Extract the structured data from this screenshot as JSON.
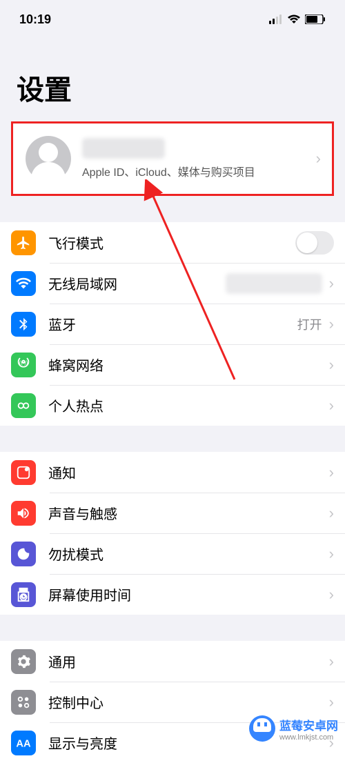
{
  "status": {
    "time": "10:19"
  },
  "title": "设置",
  "profile": {
    "subtitle": "Apple ID、iCloud、媒体与购买项目"
  },
  "sections": [
    {
      "rows": [
        {
          "icon": "airplane",
          "label": "飞行模式",
          "type": "toggle",
          "value_on": false
        },
        {
          "icon": "wifi",
          "label": "无线局域网",
          "type": "link",
          "value_blurred": true
        },
        {
          "icon": "bluetooth",
          "label": "蓝牙",
          "type": "link",
          "value": "打开"
        },
        {
          "icon": "cellular",
          "label": "蜂窝网络",
          "type": "link"
        },
        {
          "icon": "hotspot",
          "label": "个人热点",
          "type": "link"
        }
      ]
    },
    {
      "rows": [
        {
          "icon": "notifications",
          "label": "通知",
          "type": "link"
        },
        {
          "icon": "sounds",
          "label": "声音与触感",
          "type": "link"
        },
        {
          "icon": "dnd",
          "label": "勿扰模式",
          "type": "link"
        },
        {
          "icon": "screentime",
          "label": "屏幕使用时间",
          "type": "link"
        }
      ]
    },
    {
      "rows": [
        {
          "icon": "general",
          "label": "通用",
          "type": "link"
        },
        {
          "icon": "control",
          "label": "控制中心",
          "type": "link"
        },
        {
          "icon": "display",
          "label": "显示与亮度",
          "type": "link"
        }
      ]
    }
  ],
  "watermark": {
    "brand": "蓝莓安卓网",
    "url": "www.lmkjst.com"
  }
}
